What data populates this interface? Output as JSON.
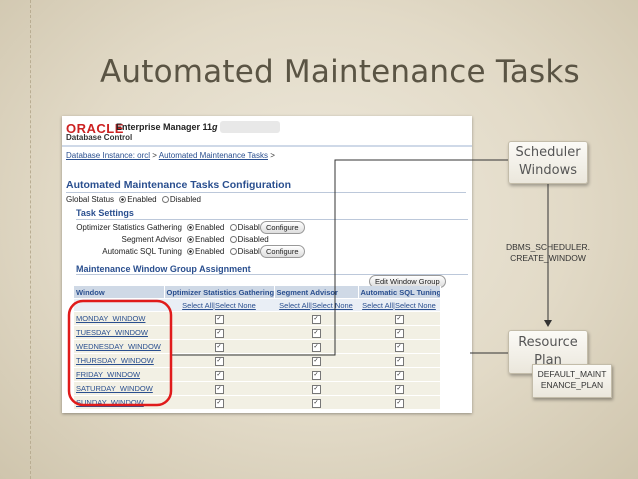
{
  "slide": {
    "title": "Automated Maintenance Tasks"
  },
  "em": {
    "oracle_logo": "ORACLE",
    "product": "Enterprise Manager 11",
    "version_suffix": "g",
    "subtitle": "Database Control",
    "breadcrumb": {
      "item1": "Database Instance: orcl",
      "sep": ">",
      "item2": "Automated Maintenance Tasks",
      "end": ">"
    },
    "page_title": "Automated Maintenance Tasks Configuration",
    "global_status": {
      "label": "Global Status",
      "enabled": "Enabled",
      "disabled": "Disabled"
    },
    "task_settings": {
      "heading": "Task Settings",
      "rows": [
        {
          "label": "Optimizer Statistics Gathering",
          "enabled": "Enabled",
          "disabled": "Disabled",
          "button": "Configure"
        },
        {
          "label": "Segment Advisor",
          "enabled": "Enabled",
          "disabled": "Disabled",
          "button": ""
        },
        {
          "label": "Automatic SQL Tuning",
          "enabled": "Enabled",
          "disabled": "Disabled",
          "button": "Configure"
        }
      ]
    },
    "window_group": {
      "heading": "Maintenance Window Group Assignment",
      "edit_button": "Edit Window Group",
      "columns": [
        "Window",
        "Optimizer Statistics Gathering",
        "Segment Advisor",
        "Automatic SQL Tuning"
      ],
      "select_all": "Select All",
      "divider": "|",
      "select_none": "Select None",
      "check_mark": "✓",
      "windows": [
        "MONDAY_WINDOW",
        "TUESDAY_WINDOW",
        "WEDNESDAY_WINDOW",
        "THURSDAY_WINDOW",
        "FRIDAY_WINDOW",
        "SATURDAY_WINDOW",
        "SUNDAY_WINDOW"
      ]
    }
  },
  "diagram": {
    "scheduler_line1": "Scheduler",
    "scheduler_line2": "Windows",
    "dbms_line1": "DBMS_SCHEDULER.",
    "dbms_line2": "CREATE_WINDOW",
    "resource_line1": "Resource",
    "resource_line2": "Plan",
    "plan_line1": "DEFAULT_MAINT",
    "plan_line2": "ENANCE_PLAN"
  },
  "colors": {
    "highlight_oval": "#e01b1b",
    "link": "#2a4f8f",
    "oracle_red": "#c22222"
  }
}
